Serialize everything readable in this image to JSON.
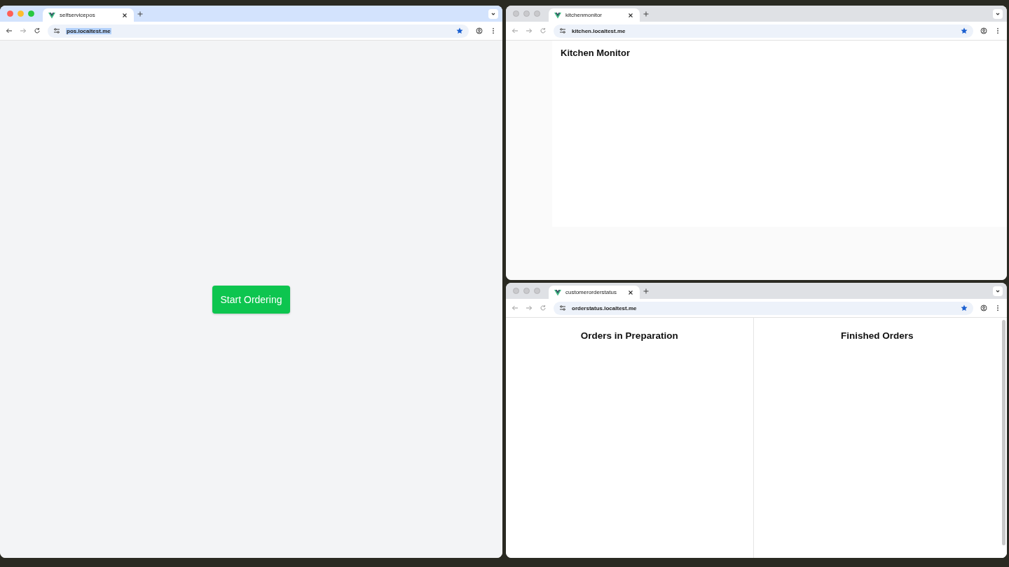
{
  "windows": [
    {
      "tab": {
        "title": "selfservicepos"
      },
      "focused": true,
      "address": {
        "url": "pos.localtest.me",
        "selected": true
      },
      "content": {
        "kind": "pos",
        "button": "Start Ordering"
      }
    },
    {
      "tab": {
        "title": "kitchenmonitor"
      },
      "focused": false,
      "address": {
        "url": "kitchen.localtest.me",
        "selected": false
      },
      "content": {
        "kind": "kitchen",
        "heading": "Kitchen Monitor"
      }
    },
    {
      "tab": {
        "title": "customerorderstatus"
      },
      "focused": false,
      "address": {
        "url": "orderstatus.localtest.me",
        "selected": false
      },
      "content": {
        "kind": "orderstatus",
        "columns": [
          "Orders in Preparation",
          "Finished Orders"
        ]
      }
    }
  ]
}
